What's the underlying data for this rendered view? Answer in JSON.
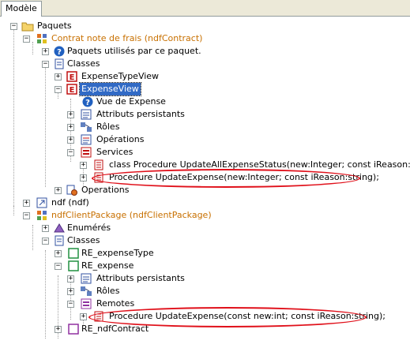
{
  "tab": {
    "label": "Modèle"
  },
  "tree": {
    "paquets": "Paquets",
    "contrat": "Contrat note de frais (ndfContract)",
    "paquets_utilises": "Paquets utilisés par ce paquet.",
    "classes": "Classes",
    "expense_type_view": "ExpenseTypeView",
    "expense_view": "ExpenseView",
    "vue_de_expense": "Vue de Expense",
    "attributs_persistants": "Attributs persistants",
    "roles": "Rôles",
    "operations_label": "Opérations",
    "services": "Services",
    "update_all": "class Procedure UpdateAllExpenseStatus(new:Integer; const iReason:string);",
    "update_expense_contract": "Procedure UpdateExpense(new:Integer; const iReason:string);",
    "operations": "Operations",
    "ndf": "ndf (ndf)",
    "ndf_client_package": "ndfClientPackage (ndfClientPackage)",
    "enumeres": "Enumérés",
    "classes2": "Classes",
    "re_expense_type": "RE_expenseType",
    "re_expense": "RE_expense",
    "attributs_persistants2": "Attributs persistants",
    "roles2": "Rôles",
    "remotes": "Remotes",
    "update_expense_client": "Procedure UpdateExpense(const new:int; const iReason:string);",
    "re_ndf_contract": "RE_ndfContract"
  },
  "colors": {
    "package_orange": "#c87000",
    "selection": "#316ac5",
    "highlight_oval": "#e0101a"
  }
}
